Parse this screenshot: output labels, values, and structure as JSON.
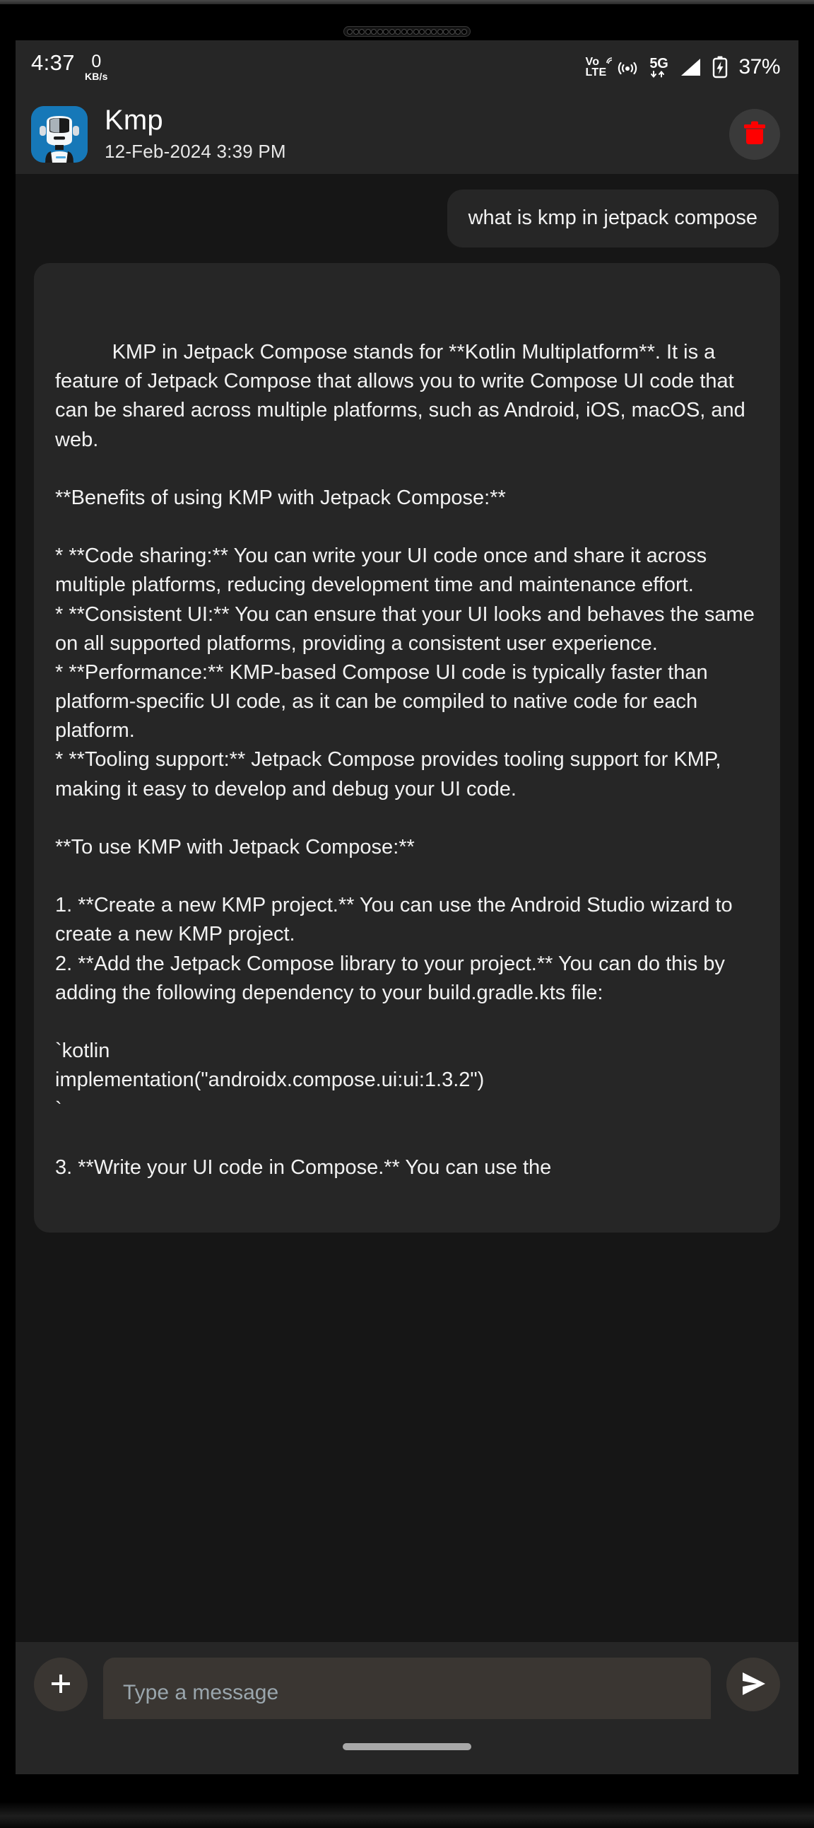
{
  "status_bar": {
    "clock": "4:37",
    "net_speed_value": "0",
    "net_speed_unit": "KB/s",
    "volte_top": "Vo",
    "volte_bottom": "LTE",
    "network_type": "5G",
    "battery_percent": "37%",
    "icons": [
      "volte-icon",
      "hotspot-icon",
      "5g-icon",
      "signal-bars-icon",
      "battery-charging-icon"
    ]
  },
  "header": {
    "title": "Kmp",
    "timestamp": "12-Feb-2024 3:39 PM",
    "avatar_name": "robot-avatar",
    "delete_icon": "trash-icon",
    "delete_color": "#ff0000",
    "avatar_bg": "#1678b8"
  },
  "messages": [
    {
      "role": "user",
      "text": "what is kmp in jetpack compose"
    },
    {
      "role": "assistant",
      "text": "KMP in Jetpack Compose stands for **Kotlin Multiplatform**. It is a feature of Jetpack Compose that allows you to write Compose UI code that can be shared across multiple platforms, such as Android, iOS, macOS, and web.\n\n**Benefits of using KMP with Jetpack Compose:**\n\n* **Code sharing:** You can write your UI code once and share it across multiple platforms, reducing development time and maintenance effort.\n* **Consistent UI:** You can ensure that your UI looks and behaves the same on all supported platforms, providing a consistent user experience.\n* **Performance:** KMP-based Compose UI code is typically faster than platform-specific UI code, as it can be compiled to native code for each platform.\n* **Tooling support:** Jetpack Compose provides tooling support for KMP, making it easy to develop and debug your UI code.\n\n**To use KMP with Jetpack Compose:**\n\n1. **Create a new KMP project.** You can use the Android Studio wizard to create a new KMP project.\n2. **Add the Jetpack Compose library to your project.** You can do this by adding the following dependency to your build.gradle.kts file:\n\n`kotlin\nimplementation(\"androidx.compose.ui:ui:1.3.2\")\n`\n\n3. **Write your UI code in Compose.** You can use the"
    }
  ],
  "composer": {
    "attach_icon": "plus-icon",
    "input_value": "",
    "input_placeholder": "Type a message",
    "send_icon": "send-icon"
  },
  "gesture_nav": {
    "pill_name": "home-gesture-pill"
  },
  "colors": {
    "screen_bg": "#262626",
    "chat_bg": "#161616",
    "bubble_bg": "#262626",
    "composer_field_bg": "#3a3632",
    "text_primary": "#f2f2f2",
    "accent_delete": "#ff0000"
  }
}
